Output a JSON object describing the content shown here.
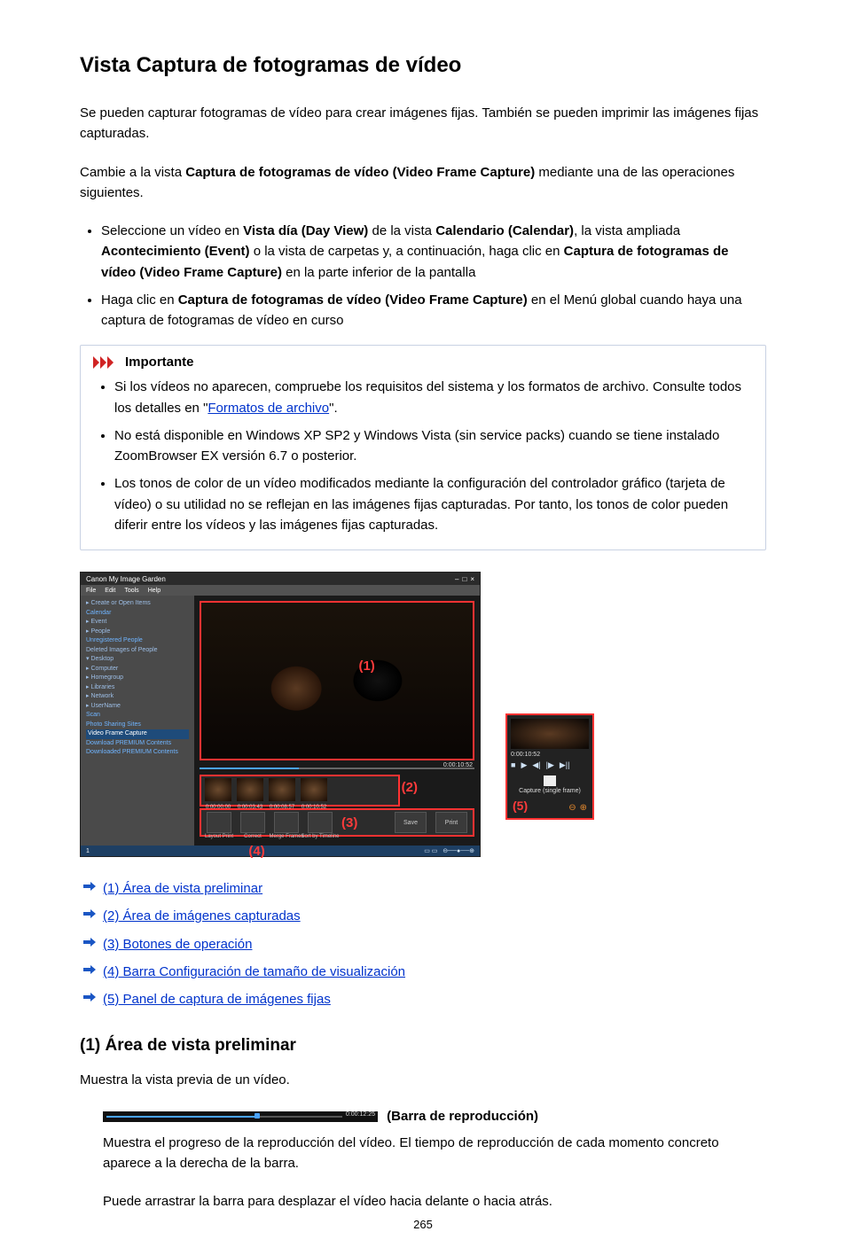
{
  "title": "Vista Captura de fotogramas de vídeo",
  "intro_p1": "Se pueden capturar fotogramas de vídeo para crear imágenes fijas. También se pueden imprimir las imágenes fijas capturadas.",
  "intro_p2a": "Cambie a la vista ",
  "intro_p2b": "Captura de fotogramas de vídeo (Video Frame Capture)",
  "intro_p2c": " mediante una de las operaciones siguientes.",
  "steps_li1_a": "Seleccione un vídeo en ",
  "steps_li1_b": "Vista día (Day View)",
  "steps_li1_c": " de la vista ",
  "steps_li1_d": "Calendario (Calendar)",
  "steps_li1_e": ", la vista ampliada ",
  "steps_li1_f": "Acontecimiento (Event)",
  "steps_li1_g": " o la vista de carpetas y, a continuación, haga clic en ",
  "steps_li1_h": "Captura de fotogramas de vídeo (Video Frame Capture)",
  "steps_li1_i": " en la parte inferior de la pantalla",
  "steps_li2_a": "Haga clic en ",
  "steps_li2_b": "Captura de fotogramas de vídeo (Video Frame Capture)",
  "steps_li2_c": " en el Menú global cuando haya una captura de fotogramas de vídeo en curso",
  "callout_title": "Importante",
  "callout_li1_a": "Si los vídeos no aparecen, compruebe los requisitos del sistema y los formatos de archivo. Consulte todos los detalles en \"",
  "callout_li1_link": "Formatos de archivo",
  "callout_li1_b": "\".",
  "callout_li2": "No está disponible en Windows XP SP2 y Windows Vista (sin service packs) cuando se tiene instalado ZoomBrowser EX versión 6.7 o posterior.",
  "callout_li3": "Los tonos de color de un vídeo modificados mediante la configuración del controlador gráfico (tarjeta de vídeo) o su utilidad no se reflejan en las imágenes fijas capturadas. Por tanto, los tonos de color pueden diferir entre los vídeos y las imágenes fijas capturadas.",
  "fig": {
    "app_title": "Canon My Image Garden",
    "menus": [
      "File",
      "Edit",
      "Tools",
      "Help"
    ],
    "sidebar": [
      "Create or Open Items",
      "Calendar",
      "Event",
      "People",
      "Unregistered People",
      "Deleted Images of People",
      "Desktop",
      "Computer",
      "Homegroup",
      "Libraries",
      "Network",
      "UserName",
      "Scan",
      "Photo Sharing Sites",
      "Video Frame Capture",
      "Download PREMIUM Contents",
      "Downloaded PREMIUM Contents"
    ],
    "time": "0:00:10:52",
    "thumbs": [
      "0:00:00.00",
      "0:00:03.43",
      "0:00:08.57",
      "0:00:10.52"
    ],
    "ops": [
      "Layout Print",
      "Correct",
      "Merge Frames",
      "Sort by Timeline"
    ],
    "btn_save": "Save",
    "btn_print": "Print",
    "label1": "(1)",
    "label2": "(2)",
    "label3": "(3)",
    "label4": "(4)",
    "label5": "(5)",
    "panel_time": "0:00:10:52",
    "panel_capture": "Capture (single frame)",
    "status_count": "1"
  },
  "anchors": {
    "a1": "(1) Área de vista preliminar",
    "a2": "(2) Área de imágenes capturadas",
    "a3": "(3) Botones de operación",
    "a4": "(4) Barra Configuración de tamaño de visualización",
    "a5": "(5) Panel de captura de imágenes fijas"
  },
  "sec1_title": "(1) Área de vista preliminar",
  "sec1_p1": "Muestra la vista previa de un vídeo.",
  "pb_label": "(Barra de reproducción)",
  "pb_time": "0:00:12:25",
  "pb_p1": "Muestra el progreso de la reproducción del vídeo. El tiempo de reproducción de cada momento concreto aparece a la derecha de la barra.",
  "pb_p2": "Puede arrastrar la barra para desplazar el vídeo hacia delante o hacia atrás.",
  "pagenum": "265"
}
